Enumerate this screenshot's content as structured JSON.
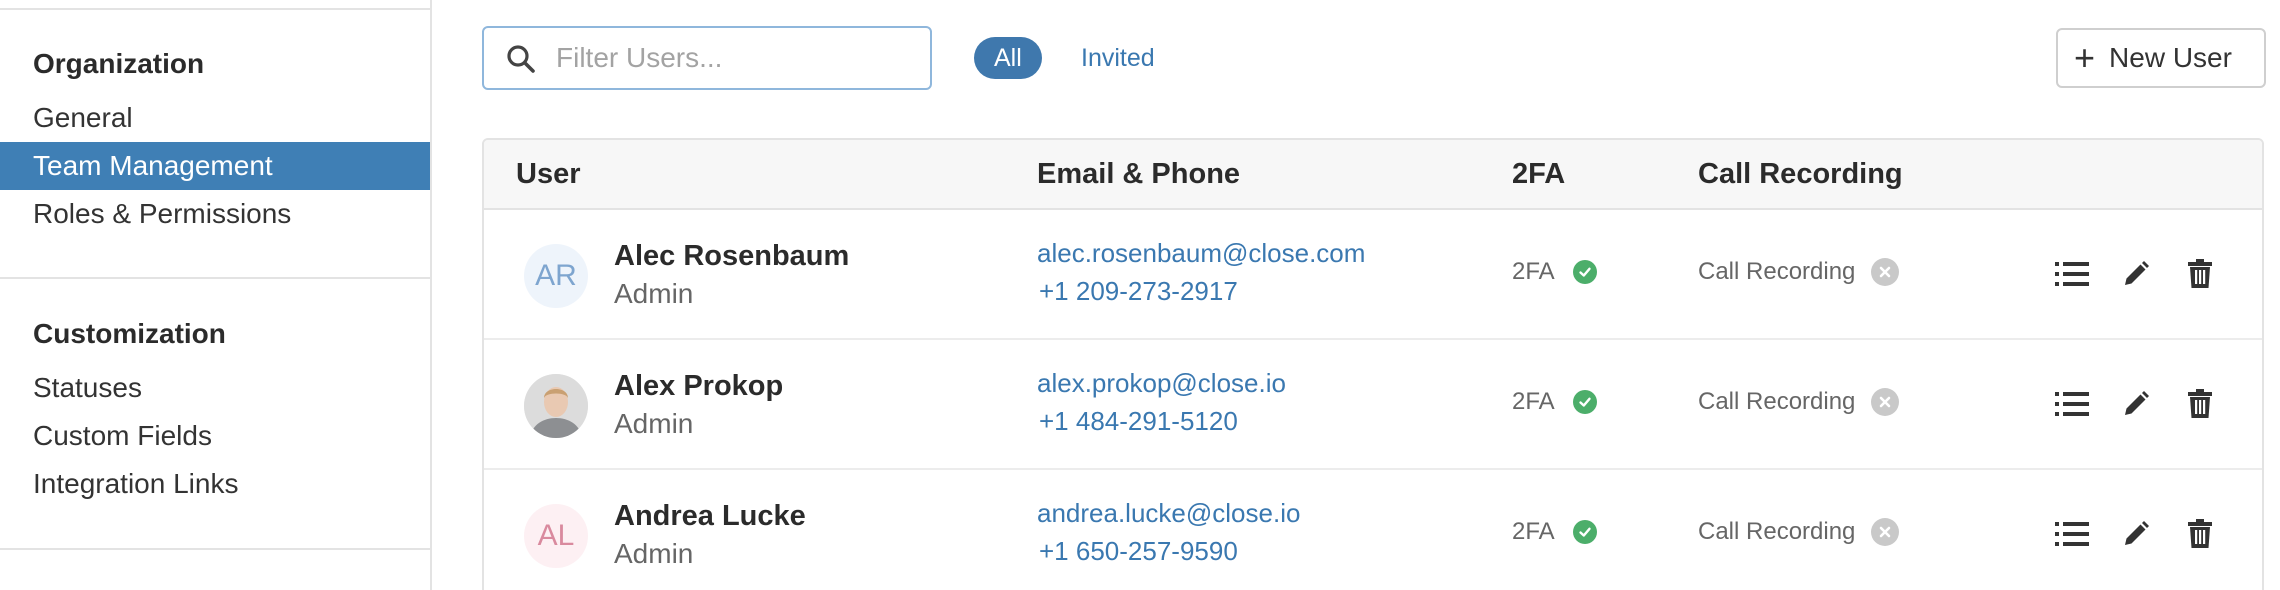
{
  "sidebar": {
    "sections": [
      {
        "heading": "Organization",
        "items": [
          "General",
          "Team Management",
          "Roles & Permissions"
        ]
      },
      {
        "heading": "Customization",
        "items": [
          "Statuses",
          "Custom Fields",
          "Integration Links"
        ]
      }
    ],
    "active_item": "Team Management"
  },
  "toolbar": {
    "search_placeholder": "Filter Users...",
    "search_value": "",
    "filters": [
      "All",
      "Invited"
    ],
    "active_filter": "All",
    "new_user_label": "New User"
  },
  "table": {
    "columns": [
      "User",
      "Email & Phone",
      "2FA",
      "Call Recording"
    ],
    "rows": [
      {
        "initials": "AR",
        "name": "Alec Rosenbaum",
        "role": "Admin",
        "email": "alec.rosenbaum@close.com",
        "phone": "+1 209-273-2917",
        "tfa_label": "2FA",
        "tfa_enabled": true,
        "recording_label": "Call Recording",
        "recording_enabled": false
      },
      {
        "initials": "",
        "name": "Alex Prokop",
        "role": "Admin",
        "email": "alex.prokop@close.io",
        "phone": "+1 484-291-5120",
        "tfa_label": "2FA",
        "tfa_enabled": true,
        "recording_label": "Call Recording",
        "recording_enabled": false
      },
      {
        "initials": "AL",
        "name": "Andrea Lucke",
        "role": "Admin",
        "email": "andrea.lucke@close.io",
        "phone": "+1 650-257-9590",
        "tfa_label": "2FA",
        "tfa_enabled": true,
        "recording_label": "Call Recording",
        "recording_enabled": false
      }
    ]
  },
  "icons": {
    "search": "search-icon",
    "plus": "plus-icon",
    "tfa_ok": "check-circle-icon",
    "recording_off": "x-circle-icon",
    "row_actions": [
      "list-icon",
      "pencil-icon",
      "trash-icon"
    ]
  },
  "colors": {
    "accent": "#3f7fb5",
    "link": "#3a78b0",
    "success": "#4cae6a",
    "disabled": "#c9c9c9"
  }
}
